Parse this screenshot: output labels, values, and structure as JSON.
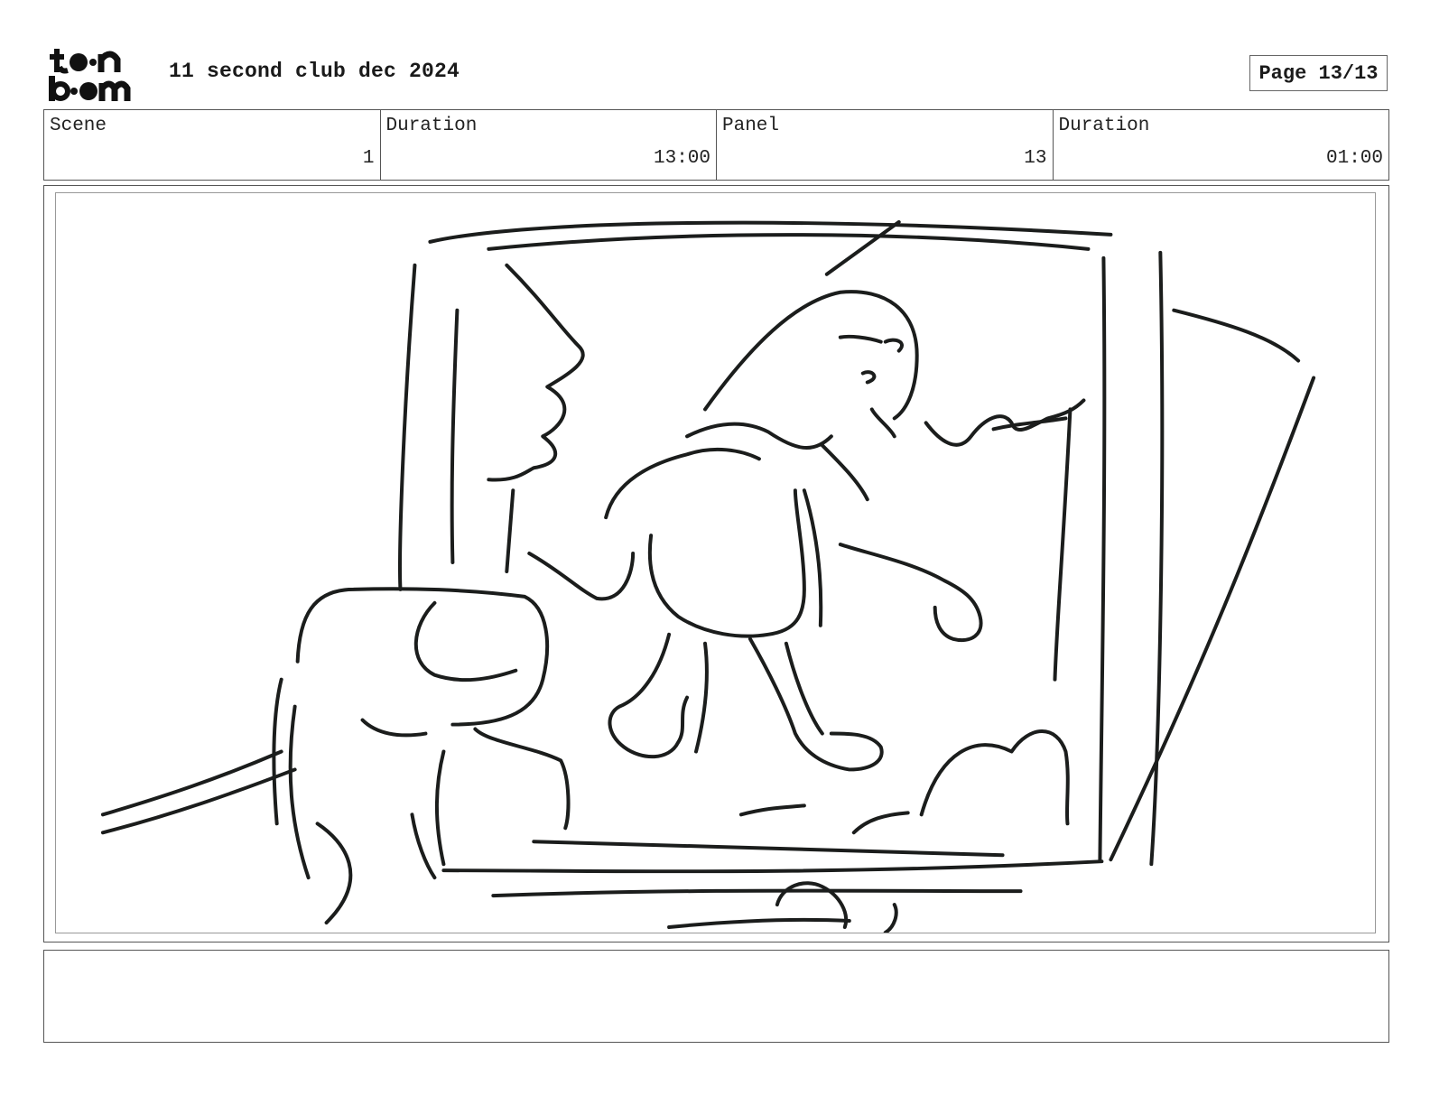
{
  "header": {
    "logo_text": "toon boom",
    "title": "11 second club dec 2024",
    "page_label": "Page 13/13"
  },
  "info": [
    {
      "label": "Scene",
      "value": "1"
    },
    {
      "label": "Duration",
      "value": "13:00"
    },
    {
      "label": "Panel",
      "value": "13"
    },
    {
      "label": "Duration",
      "value": "01:00"
    }
  ],
  "panel": {
    "image_name": "storyboard-sketch",
    "line_color": "#1b1d1c"
  },
  "notes": {
    "text": ""
  }
}
